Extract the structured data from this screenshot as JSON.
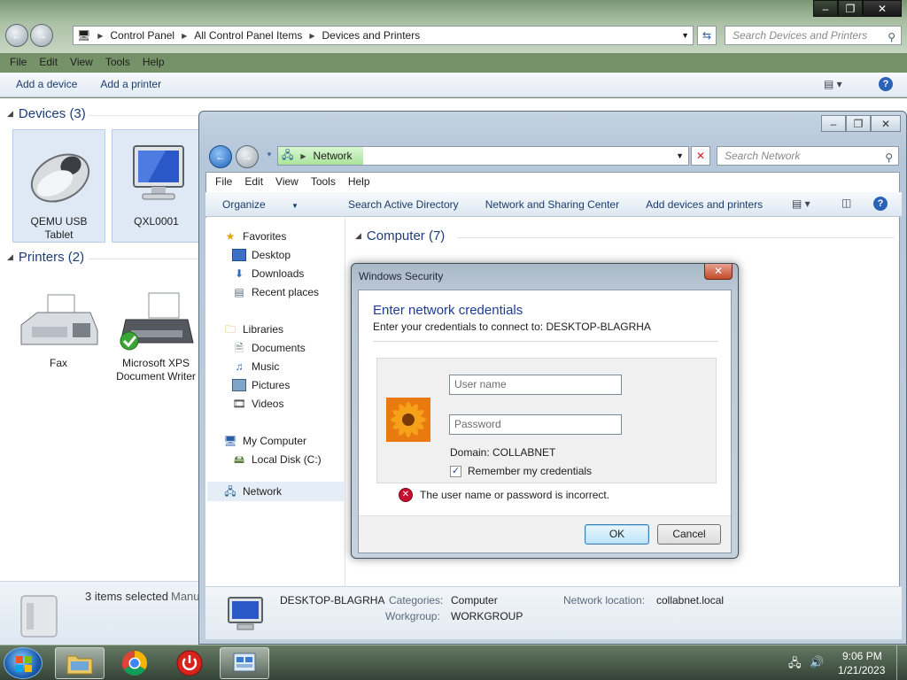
{
  "bg_window": {
    "breadcrumb": [
      "Control Panel",
      "All Control Panel Items",
      "Devices and Printers"
    ],
    "search_placeholder": "Search Devices and Printers",
    "menu": [
      "File",
      "Edit",
      "View",
      "Tools",
      "Help"
    ],
    "commands": [
      "Add a device",
      "Add a printer"
    ],
    "devices_header": "Devices (3)",
    "devices": [
      {
        "label_line1": "QEMU USB",
        "label_line2": "Tablet"
      },
      {
        "label_line1": "QXL0001",
        "label_line2": ""
      }
    ],
    "printers_header": "Printers (2)",
    "printers": [
      {
        "label_line1": "Fax",
        "label_line2": ""
      },
      {
        "label_line1": "Microsoft XPS",
        "label_line2": "Document Writer"
      }
    ],
    "status_text": "3 items selected",
    "status_text_cut": "Manu"
  },
  "net_window": {
    "address": "Network",
    "search_placeholder": "Search Network",
    "menu": [
      "File",
      "Edit",
      "View",
      "Tools",
      "Help"
    ],
    "commands": [
      "Organize",
      "Search Active Directory",
      "Network and Sharing Center",
      "Add devices and printers"
    ],
    "nav": {
      "favorites": "Favorites",
      "desktop": "Desktop",
      "downloads": "Downloads",
      "recent": "Recent places",
      "libraries": "Libraries",
      "documents": "Documents",
      "music": "Music",
      "pictures": "Pictures",
      "videos": "Videos",
      "my_computer": "My Computer",
      "local_disk": "Local Disk (C:)",
      "network": "Network"
    },
    "group_header": "Computer (7)",
    "details": {
      "name": "DESKTOP-BLAGRHA",
      "categories_label": "Categories:",
      "categories_value": "Computer",
      "workgroup_label": "Workgroup:",
      "workgroup_value": "WORKGROUP",
      "location_label": "Network location:",
      "location_value": "collabnet.local"
    }
  },
  "dialog": {
    "title": "Windows Security",
    "heading": "Enter network credentials",
    "subheading": "Enter your credentials to connect to: DESKTOP-BLAGRHA",
    "username_placeholder": "User name",
    "password_placeholder": "Password",
    "domain": "Domain: COLLABNET",
    "remember": "Remember my credentials",
    "remember_checked": true,
    "error": "The user name or password is incorrect.",
    "ok": "OK",
    "cancel": "Cancel"
  },
  "taskbar": {
    "time": "9:06 PM",
    "date": "1/21/2023"
  },
  "colors": {
    "link_blue": "#1e3c78",
    "heading_blue": "#1e3c96",
    "error_red": "#c8102e"
  }
}
